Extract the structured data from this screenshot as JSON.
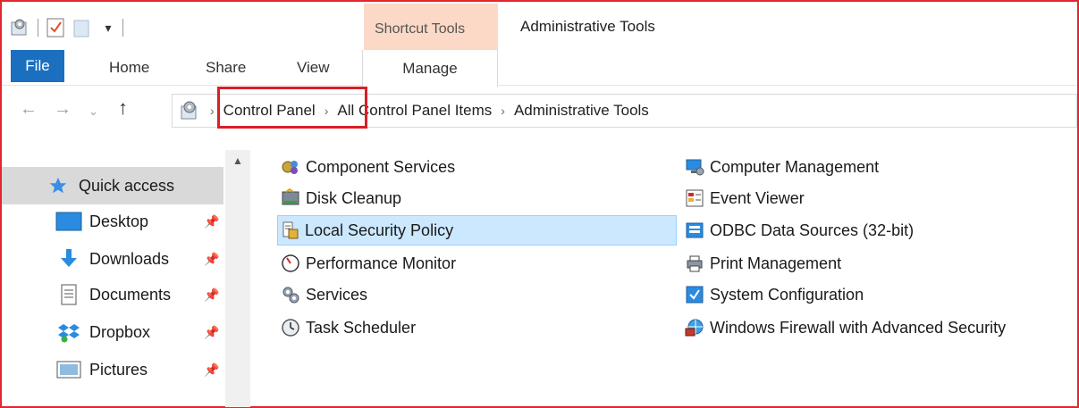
{
  "window": {
    "title": "Administrative Tools",
    "context_tab_group": "Shortcut Tools"
  },
  "ribbon": {
    "tabs": [
      {
        "label": "File"
      },
      {
        "label": "Home"
      },
      {
        "label": "Share"
      },
      {
        "label": "View"
      },
      {
        "label": "Manage"
      }
    ]
  },
  "address": {
    "breadcrumbs": [
      "Control Panel",
      "All Control Panel Items",
      "Administrative Tools"
    ],
    "highlighted_crumb": "Control Panel"
  },
  "nav_pane": {
    "items": [
      {
        "label": "Quick access",
        "icon": "star-icon"
      },
      {
        "label": "Desktop",
        "icon": "desktop-icon",
        "pinned": true
      },
      {
        "label": "Downloads",
        "icon": "download-arrow-icon",
        "pinned": true
      },
      {
        "label": "Documents",
        "icon": "document-icon",
        "pinned": true
      },
      {
        "label": "Dropbox",
        "icon": "dropbox-icon",
        "pinned": true
      },
      {
        "label": "Pictures",
        "icon": "pictures-icon",
        "pinned": true
      }
    ]
  },
  "content": {
    "left_column": [
      {
        "label": "Component Services"
      },
      {
        "label": "Disk Cleanup"
      },
      {
        "label": "Local Security Policy",
        "selected": true
      },
      {
        "label": "Performance Monitor"
      },
      {
        "label": "Services"
      },
      {
        "label": "Task Scheduler"
      }
    ],
    "right_column": [
      {
        "label": "Computer Management"
      },
      {
        "label": "Event Viewer"
      },
      {
        "label": "ODBC Data Sources (32-bit)"
      },
      {
        "label": "Print Management"
      },
      {
        "label": "System Configuration"
      },
      {
        "label": "Windows Firewall with Advanced Security"
      }
    ]
  },
  "colors": {
    "accent": "#1a6fbf",
    "highlight_border": "#d81f27",
    "selection": "#cce8ff",
    "context_tab": "#fbd9c6"
  }
}
